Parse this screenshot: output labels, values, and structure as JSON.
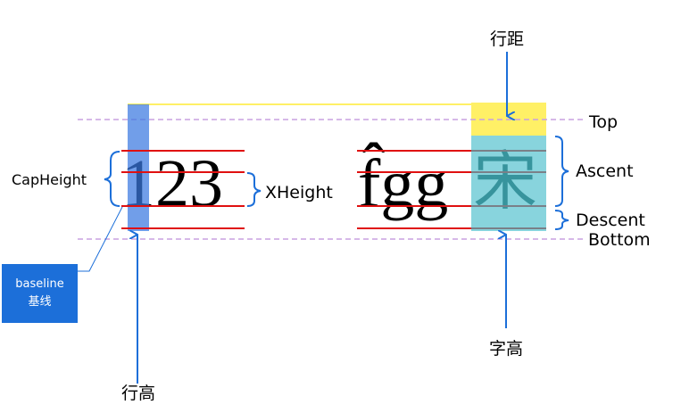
{
  "labels": {
    "line_spacing": "行距",
    "top": "Top",
    "ascent": "Ascent",
    "descent": "Descent",
    "bottom": "Bottom",
    "cap_height": "CapHeight",
    "x_height": "XHeight",
    "line_height": "行高",
    "char_height": "字高"
  },
  "baseline_badge": {
    "en": "baseline",
    "zh": "基线"
  },
  "samples": {
    "digits": "123",
    "latin": "f̂gg",
    "cjk": "宋"
  },
  "colors": {
    "accent_blue": "#1c6fd9",
    "red_line": "#e01010",
    "dashed_purple": "#c9a0e0",
    "leading_yellow": "#fff066",
    "ascent_cyan": "#88d4dd",
    "line_height_blue": "#6a9ee8"
  }
}
